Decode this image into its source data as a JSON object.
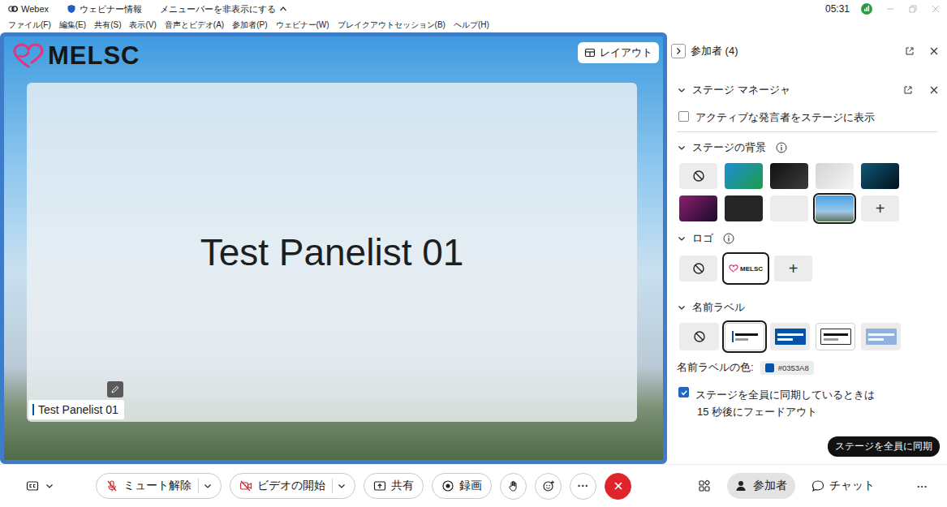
{
  "window": {
    "app_name": "Webex",
    "webinar_info": "ウェビナー情報",
    "hide_menubar": "メニューバーを非表示にする",
    "clock": "05:31"
  },
  "menu": [
    "ファイル(F)",
    "編集(E)",
    "共有(S)",
    "表示(V)",
    "音声とビデオ(A)",
    "参加者(P)",
    "ウェビナー(W)",
    "ブレイクアウトセッション(B)",
    "ヘルプ(H)"
  ],
  "stage": {
    "logo": "MELSC",
    "layout_button": "レイアウト",
    "presenter": "Test Panelist 01",
    "name_label": "Test Panelist 01"
  },
  "participants_panel": {
    "title": "参加者 (4)"
  },
  "stage_manager": {
    "title": "ステージ マネージャ",
    "expanded": true,
    "show_active_speaker": {
      "label": "アクティブな発言者をステージに表示",
      "checked": false
    },
    "background": {
      "title": "ステージの背景",
      "expanded": true,
      "options": [
        {
          "kind": "none",
          "selected": false
        },
        {
          "kind": "gradient",
          "color": "#1c8fd6",
          "color_end": "#1f9a4a",
          "selected": false
        },
        {
          "kind": "gradient",
          "color": "#111111",
          "color_end": "#3c3c3c",
          "selected": false
        },
        {
          "kind": "gradient",
          "color": "#d4d4d4",
          "color_end": "#f5f5f5",
          "selected": false
        },
        {
          "kind": "gradient",
          "color": "#0d5878",
          "color_end": "#03121c",
          "selected": false
        },
        {
          "kind": "gradient",
          "color": "#8a1f6e",
          "color_end": "#1a0b2c",
          "selected": false
        },
        {
          "kind": "solid",
          "color": "#262626",
          "selected": false
        },
        {
          "kind": "solid",
          "color": "#ececec",
          "selected": false
        },
        {
          "kind": "image",
          "selected": true
        },
        {
          "kind": "add",
          "text": "+",
          "selected": false
        }
      ]
    },
    "logo": {
      "title": "ロゴ",
      "expanded": true,
      "options": [
        {
          "kind": "none",
          "selected": false
        },
        {
          "kind": "logo",
          "text": "MELSC",
          "selected": true
        },
        {
          "kind": "add",
          "text": "+",
          "selected": false
        }
      ]
    },
    "name_label": {
      "title": "名前ラベル",
      "expanded": true,
      "options": [
        {
          "kind": "none",
          "selected": false
        },
        {
          "kind": "plain",
          "selected": true
        },
        {
          "kind": "filled",
          "selected": false
        },
        {
          "kind": "boxed",
          "selected": false
        },
        {
          "kind": "light",
          "selected": false
        }
      ]
    },
    "name_label_color": {
      "label": "名前ラベルの色:",
      "value": "#0353A8",
      "color": "#0353A8"
    },
    "fade_out": {
      "lines": [
        "ステージを全員に同期しているときは",
        "15 秒後にフェードアウト"
      ],
      "checked": true
    },
    "sync_button": "ステージを全員に同期"
  },
  "toolbar": {
    "mute_button": {
      "label": "ミュート解除",
      "muted": true
    },
    "video_button": {
      "label": "ビデオの開始",
      "video_on": false
    },
    "share_button": "共有",
    "record_button": "録画",
    "more": "···",
    "participants_button": {
      "label": "参加者",
      "selected": true
    },
    "chat_button": {
      "label": "チャット",
      "selected": false
    },
    "panel_more": "···"
  }
}
